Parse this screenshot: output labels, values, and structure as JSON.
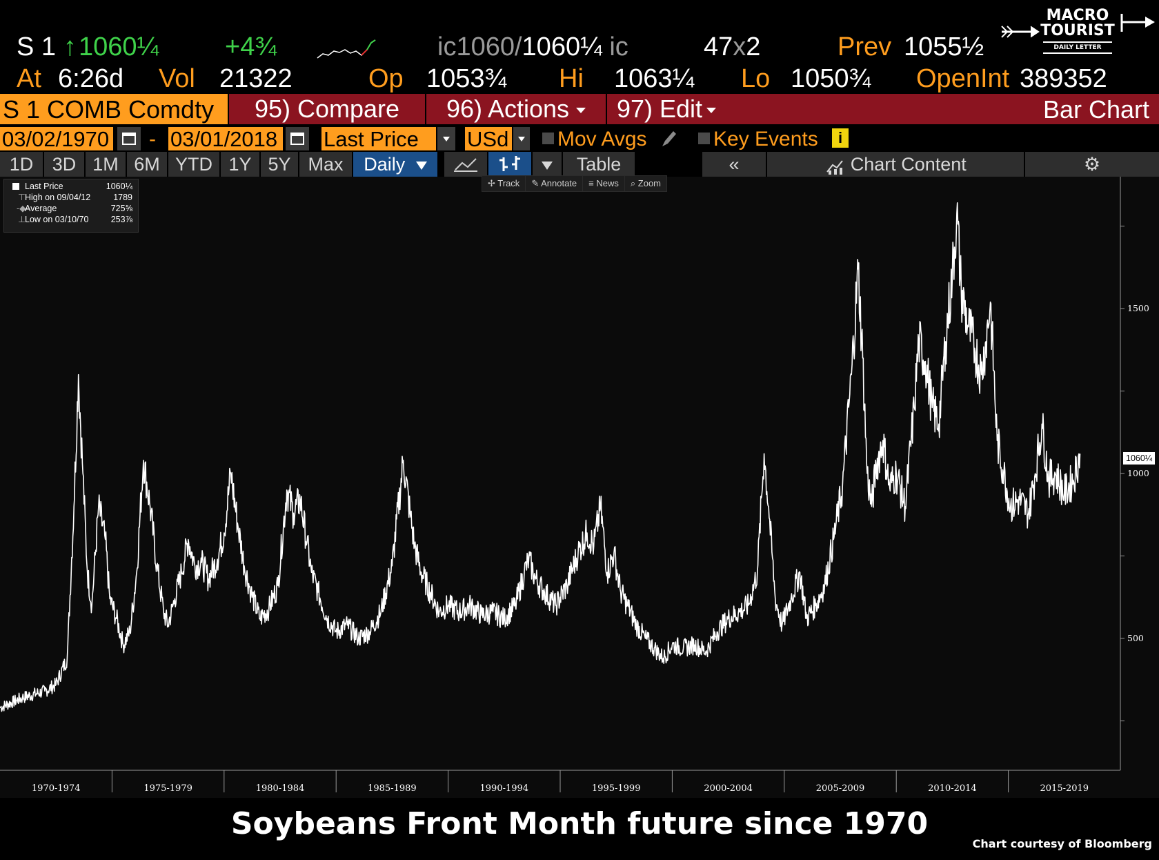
{
  "quote": {
    "ticker": "S 1",
    "last_price": "1060¼",
    "change": "+4¾",
    "bid_ask_prefix": "ic1060",
    "bid_ask_sep": "/",
    "ask": "1060¼",
    "bid_ask_suffix": "ic",
    "size": "47",
    "size_sep": "x",
    "size2": "2",
    "prev_label": "Prev",
    "prev_value": "1055½",
    "at_label": "At",
    "at_value": "6:26d",
    "vol_label": "Vol",
    "vol_value": "21322",
    "op_label": "Op",
    "op_value": "1053¾",
    "hi_label": "Hi",
    "hi_value": "1063¼",
    "lo_label": "Lo",
    "lo_value": "1050¾",
    "openint_label": "OpenInt",
    "openint_value": "389352"
  },
  "logo": {
    "line1": "MACRO",
    "line2": "TOURIST",
    "line3": "DAILY LETTER"
  },
  "toolbar": {
    "security": "S 1 COMB Comdty",
    "compare": "95) Compare",
    "actions": "96) Actions",
    "edit": "97) Edit",
    "chart_type": "Bar Chart"
  },
  "controls": {
    "start_date": "03/02/1970",
    "dash": "-",
    "end_date": "03/01/2018",
    "field": "Last Price",
    "currency": "USd",
    "mov_avgs": "Mov Avgs",
    "key_events": "Key Events"
  },
  "periods": [
    "1D",
    "3D",
    "1M",
    "6M",
    "YTD",
    "1Y",
    "5Y",
    "Max"
  ],
  "frequency": "Daily",
  "table_label": "Table",
  "chart_content_label": "Chart Content",
  "tools": [
    "Track",
    "Annotate",
    "News",
    "Zoom"
  ],
  "legend": {
    "last_price_label": "Last Price",
    "last_price_value": "1060¼",
    "high_label": "High on 09/04/12",
    "high_value": "1789",
    "avg_label": "Average",
    "avg_value": "725⅝",
    "low_label": "Low on 03/10/70",
    "low_value": "253⅞"
  },
  "colors": {
    "orange": "#ff9d1e",
    "green": "#3fd24a",
    "bar_red": "#8b1420",
    "active_blue": "#1b4f8a"
  },
  "chart_data": {
    "type": "line",
    "title": "Soybeans Front Month future since 1970",
    "x_axis_labels": [
      "1970-1974",
      "1975-1979",
      "1980-1984",
      "1985-1989",
      "1990-1994",
      "1995-1999",
      "2000-2004",
      "2005-2009",
      "2010-2014",
      "2015-2019"
    ],
    "y_ticks": [
      500,
      1000,
      1500
    ],
    "ylim": [
      100,
      1900
    ],
    "xlim": [
      1970.0,
      2020.0
    ],
    "last_value_label": "1060¼",
    "series": [
      {
        "x": [
          1970.0,
          1971.0,
          1972.0,
          1972.5,
          1973.0,
          1973.3,
          1973.5,
          1973.7,
          1973.9,
          1974.1,
          1974.4,
          1974.7,
          1974.9,
          1975.2,
          1975.5,
          1975.8,
          1976.1,
          1976.4,
          1976.7,
          1977.0,
          1977.3,
          1977.5,
          1977.8,
          1978.1,
          1978.4,
          1978.7,
          1979.0,
          1979.3,
          1979.7,
          1980.0,
          1980.3,
          1980.6,
          1980.9,
          1981.2,
          1981.6,
          1982.0,
          1982.4,
          1982.8,
          1983.1,
          1983.4,
          1983.7,
          1983.9,
          1984.2,
          1984.6,
          1985.0,
          1985.5,
          1986.0,
          1986.5,
          1987.0,
          1987.5,
          1988.0,
          1988.3,
          1988.5,
          1988.8,
          1989.2,
          1989.6,
          1990.0,
          1990.5,
          1991.0,
          1991.5,
          1992.0,
          1992.5,
          1993.0,
          1993.4,
          1993.6,
          1993.9,
          1994.3,
          1994.8,
          1995.3,
          1995.8,
          1996.2,
          1996.5,
          1996.8,
          1997.1,
          1997.4,
          1997.7,
          1998.0,
          1998.4,
          1998.8,
          1999.2,
          1999.6,
          2000.0,
          2000.5,
          2001.0,
          2001.5,
          2002.0,
          2002.5,
          2003.0,
          2003.4,
          2003.8,
          2004.1,
          2004.3,
          2004.6,
          2004.9,
          2005.3,
          2005.7,
          2006.0,
          2006.4,
          2006.8,
          2007.2,
          2007.6,
          2008.0,
          2008.3,
          2008.5,
          2008.7,
          2008.9,
          2009.1,
          2009.4,
          2009.7,
          2010.0,
          2010.4,
          2010.8,
          2011.0,
          2011.3,
          2011.6,
          2011.9,
          2012.2,
          2012.5,
          2012.7,
          2012.9,
          2013.2,
          2013.5,
          2013.8,
          2014.0,
          2014.2,
          2014.5,
          2014.8,
          2015.1,
          2015.5,
          2015.9,
          2016.2,
          2016.5,
          2016.8,
          2017.1,
          2017.5,
          2017.9,
          2018.2
        ],
        "y": [
          290,
          320,
          340,
          360,
          440,
          900,
          1300,
          1000,
          700,
          600,
          900,
          800,
          620,
          560,
          480,
          520,
          700,
          1040,
          900,
          720,
          580,
          540,
          620,
          700,
          800,
          720,
          730,
          680,
          740,
          820,
          1000,
          850,
          720,
          640,
          560,
          590,
          660,
          950,
          880,
          920,
          790,
          700,
          640,
          560,
          520,
          540,
          500,
          520,
          580,
          720,
          1040,
          880,
          780,
          700,
          640,
          580,
          600,
          580,
          600,
          570,
          580,
          560,
          600,
          700,
          740,
          680,
          640,
          600,
          660,
          760,
          820,
          780,
          900,
          700,
          760,
          640,
          600,
          540,
          500,
          470,
          440,
          480,
          470,
          480,
          460,
          520,
          560,
          580,
          600,
          700,
          1060,
          900,
          620,
          540,
          620,
          700,
          560,
          600,
          660,
          800,
          960,
          1300,
          1620,
          1350,
          1000,
          900,
          1020,
          1100,
          960,
          1000,
          900,
          1200,
          1400,
          1340,
          1200,
          1150,
          1400,
          1600,
          1789,
          1550,
          1450,
          1380,
          1300,
          1400,
          1520,
          1100,
          1000,
          900,
          920,
          880,
          1000,
          1150,
          980,
          1000,
          940,
          980,
          1060
        ]
      }
    ]
  }
}
